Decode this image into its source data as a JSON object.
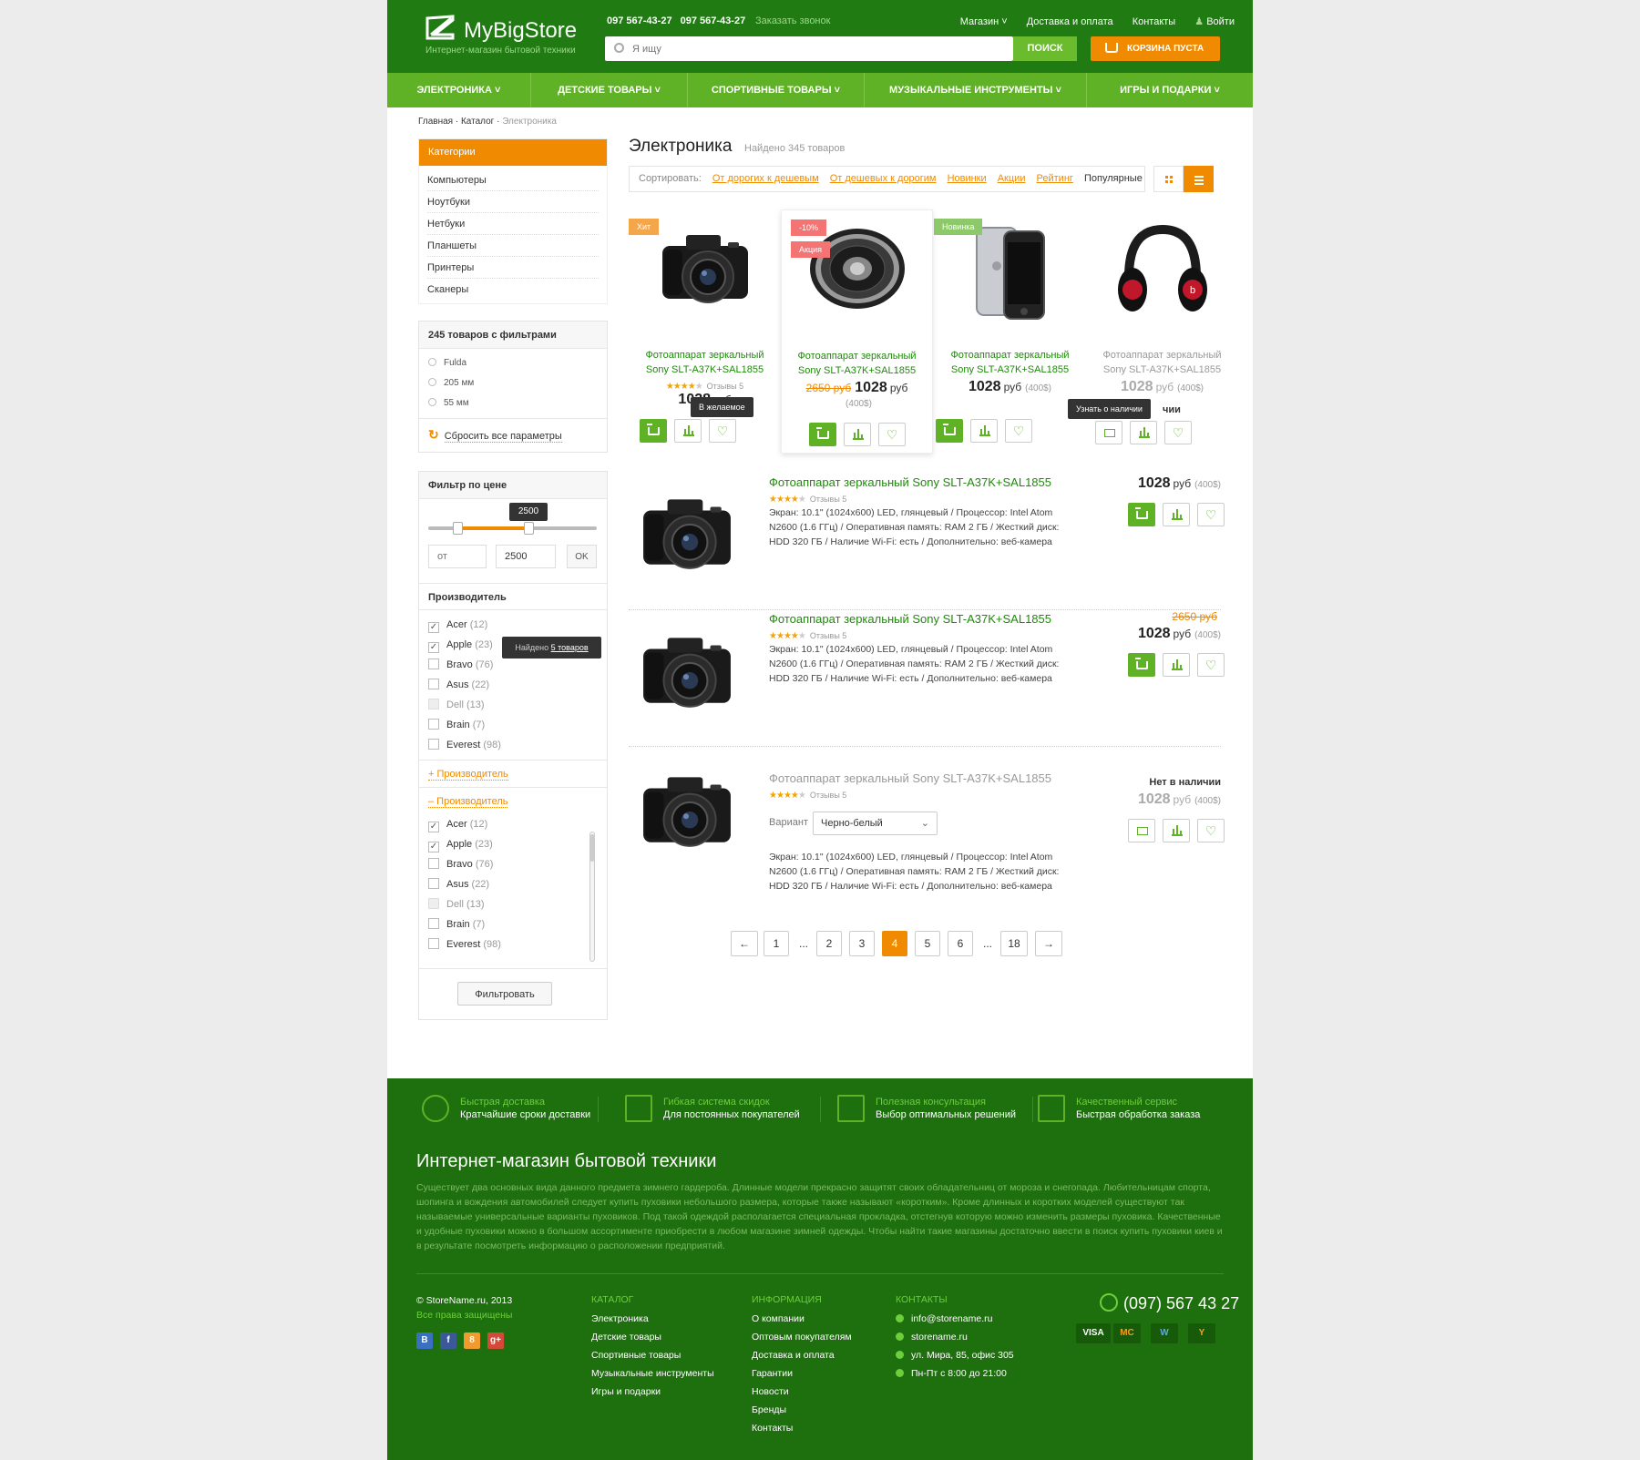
{
  "header": {
    "logo": "MyBigStore",
    "tagline": "Интернет-магазин бытовой техники",
    "phone1": "097 567-43-27",
    "phone2": "097 567-43-27",
    "callback": "Заказать звонок",
    "nav": [
      "Магазин",
      "Доставка и оплата",
      "Контакты",
      "Войти"
    ],
    "search_placeholder": "Я ищу",
    "search_button": "ПОИСК",
    "cart_label": "КОРЗИНА ПУСТА"
  },
  "main_nav": [
    "ЭЛЕКТРОНИКА",
    "ДЕТСКИЕ ТОВАРЫ",
    "СПОРТИВНЫЕ ТОВАРЫ",
    "МУЗЫКАЛЬНЫЕ ИНСТРУМЕНТЫ",
    "ИГРЫ И ПОДАРКИ"
  ],
  "breadcrumb": [
    "Главная",
    "Каталог",
    "Электроника"
  ],
  "sidebar": {
    "categories_title": "Категории",
    "categories": [
      "Компьютеры",
      "Ноутбуки",
      "Нетбуки",
      "Планшеты",
      "Принтеры",
      "Сканеры"
    ],
    "filters_title": "245 товаров с фильтрами",
    "active_filters": [
      "Fulda",
      "205 мм",
      "55 мм"
    ],
    "reset": "Сбросить все параметры",
    "price_title": "Фильтр по цене",
    "price_tip": "2500",
    "price_from_placeholder": "от",
    "price_to": "2500",
    "price_ok": "OK",
    "maker_title": "Производитель",
    "makers": [
      {
        "name": "Acer",
        "count": "(12)",
        "checked": true
      },
      {
        "name": "Apple",
        "count": "(23)",
        "checked": true
      },
      {
        "name": "Bravo",
        "count": "(76)",
        "checked": false
      },
      {
        "name": "Asus",
        "count": "(22)",
        "checked": false
      },
      {
        "name": "Dell",
        "count": "(13)",
        "checked": false,
        "disabled": true
      },
      {
        "name": "Brain",
        "count": "(7)",
        "checked": false
      },
      {
        "name": "Everest",
        "count": "(98)",
        "checked": false
      }
    ],
    "found_tip_prefix": "Найдено",
    "found_tip_link": "5 товаров",
    "maker_link_plus": "+ Производитель",
    "maker_link_minus": "– Производитель",
    "filter_button": "Фильтровать"
  },
  "main": {
    "title": "Электроника",
    "found": "Найдено 345 товаров",
    "sort_label": "Сортировать:",
    "sort_links": [
      "От дорогих к дешевым",
      "От дешевых к дорогим",
      "Новинки",
      "Акции",
      "Рейтинг"
    ],
    "sort_active": "Популярные",
    "cards": [
      {
        "name1": "Фотоаппарат зеркальный",
        "name2": "Sony SLT-A37K+SAL1855",
        "rating": 4,
        "reviews": "Отзывы 5",
        "price": "1028",
        "rub": "руб",
        "tag": "Хит",
        "tip": "В желаемое"
      },
      {
        "name1": "Фотоаппарат зеркальный",
        "name2": "Sony SLT-A37K+SAL1855",
        "old": "2650 руб",
        "price": "1028",
        "rub": "руб",
        "usd": "(400$)",
        "tag1": "-10%",
        "tag2": "Акция"
      },
      {
        "name1": "Фотоаппарат зеркальный",
        "name2": "Sony SLT-A37K+SAL1855",
        "price": "1028",
        "rub": "руб",
        "usd": "(400$)",
        "tag": "Новинка"
      },
      {
        "name1": "Фотоаппарат зеркальный",
        "name2": "Sony SLT-A37K+SAL1855",
        "price": "1028",
        "rub": "руб",
        "usd": "(400$)",
        "tip": "Узнать о наличии",
        "tip_extra": "чии"
      }
    ],
    "rows": [
      {
        "name": "Фотоаппарат зеркальный Sony SLT-A37K+SAL1855",
        "rating": 4,
        "reviews": "Отзывы 5",
        "desc": "Экран: 10.1\" (1024x600) LED, глянцевый / Процессор: Intel Atom N2600 (1.6 ГГц) / Оперативная память: RAM 2 ГБ / Жесткий диск: HDD 320 ГБ / Наличие Wi-Fi: есть / Дополнительно: веб-камера",
        "price": "1028",
        "rub": "руб",
        "usd": "(400$)"
      },
      {
        "name": "Фотоаппарат зеркальный Sony SLT-A37K+SAL1855",
        "rating": 4,
        "reviews": "Отзывы 5",
        "desc": "Экран: 10.1\" (1024x600) LED, глянцевый / Процессор: Intel Atom N2600 (1.6 ГГц) / Оперативная память: RAM 2 ГБ / Жесткий диск: HDD 320 ГБ / Наличие Wi-Fi: есть / Дополнительно: веб-камера",
        "old": "2650 руб",
        "price": "1028",
        "rub": "руб",
        "usd": "(400$)"
      },
      {
        "name": "Фотоаппарат зеркальный Sony SLT-A37K+SAL1855",
        "rating": 4,
        "reviews": "Отзывы 5",
        "variant_label": "Вариант",
        "variant_value": "Черно-белый",
        "desc": "Экран: 10.1\" (1024x600) LED, глянцевый / Процессор: Intel Atom N2600 (1.6 ГГц) / Оперативная память: RAM 2 ГБ / Жесткий диск: HDD 320 ГБ / Наличие Wi-Fi: есть / Дополнительно: веб-камера",
        "stock": "Нет в наличии",
        "price": "1028",
        "rub": "руб",
        "usd": "(400$)"
      }
    ],
    "pager": {
      "prev": "←",
      "next": "→",
      "pages": [
        "1",
        "...",
        "2",
        "3",
        "4",
        "5",
        "6",
        "...",
        "18"
      ],
      "current": "4"
    }
  },
  "footer": {
    "features": [
      {
        "t1": "Быстрая доставка",
        "t2": "Кратчайшие сроки доставки"
      },
      {
        "t1": "Гибкая система скидок",
        "t2": "Для постоянных покупателей"
      },
      {
        "t1": "Полезная консультация",
        "t2": "Выбор оптимальных решений"
      },
      {
        "t1": "Качественный сервис",
        "t2": "Быстрая обработка заказа"
      }
    ],
    "title": "Интернет-магазин бытовой техники",
    "text": "Существует два основных вида данного предмета зимнего гардероба. Длинные модели прекрасно защитят своих обладательниц от мороза и снегопада. Любительницам спорта, шопинга и вождения автомобилей следует купить пуховики небольшого размера, которые также называют «коротким». Кроме длинных и коротких моделей существуют так называемые универсальные варианты пуховиков. Под такой одеждой располагается специальная прокладка, отстегнув которую можно изменить размеры пуховика. Качественные и удобные пуховики можно в большом ассортименте приобрести в любом магазине зимней одежды. Чтобы найти такие магазины достаточно ввести в поиск купить пуховики киев и в результате посмотреть информацию о расположении предприятий.",
    "copyright": "© StoreName.ru, 2013",
    "rights": "Все права защищены",
    "social": [
      "В",
      "f",
      "8",
      "g+"
    ],
    "catalog_title": "КАТАЛОГ",
    "catalog": [
      "Электроника",
      "Детские товары",
      "Спортивные товары",
      "Музыкальные инструменты",
      "Игры и подарки"
    ],
    "info_title": "ИНФОРМАЦИЯ",
    "info": [
      "О компании",
      "Оптовым покупателям",
      "Доставка и оплата",
      "Гарантии",
      "Новости",
      "Бренды",
      "Контакты"
    ],
    "contacts_title": "КОНТАКТЫ",
    "contacts": [
      "info@storename.ru",
      "storename.ru",
      "ул. Мира, 85, офис 305",
      "Пн-Пт с 8:00 до 21:00"
    ],
    "phone": "(097) 567 43 27",
    "payments": [
      "VISA",
      "MC",
      "W",
      "Y"
    ]
  },
  "colors": {
    "green_dark": "#1f7b12",
    "green_light": "#5fb125",
    "orange": "#f08a00",
    "footer": "#1e6f0e"
  }
}
